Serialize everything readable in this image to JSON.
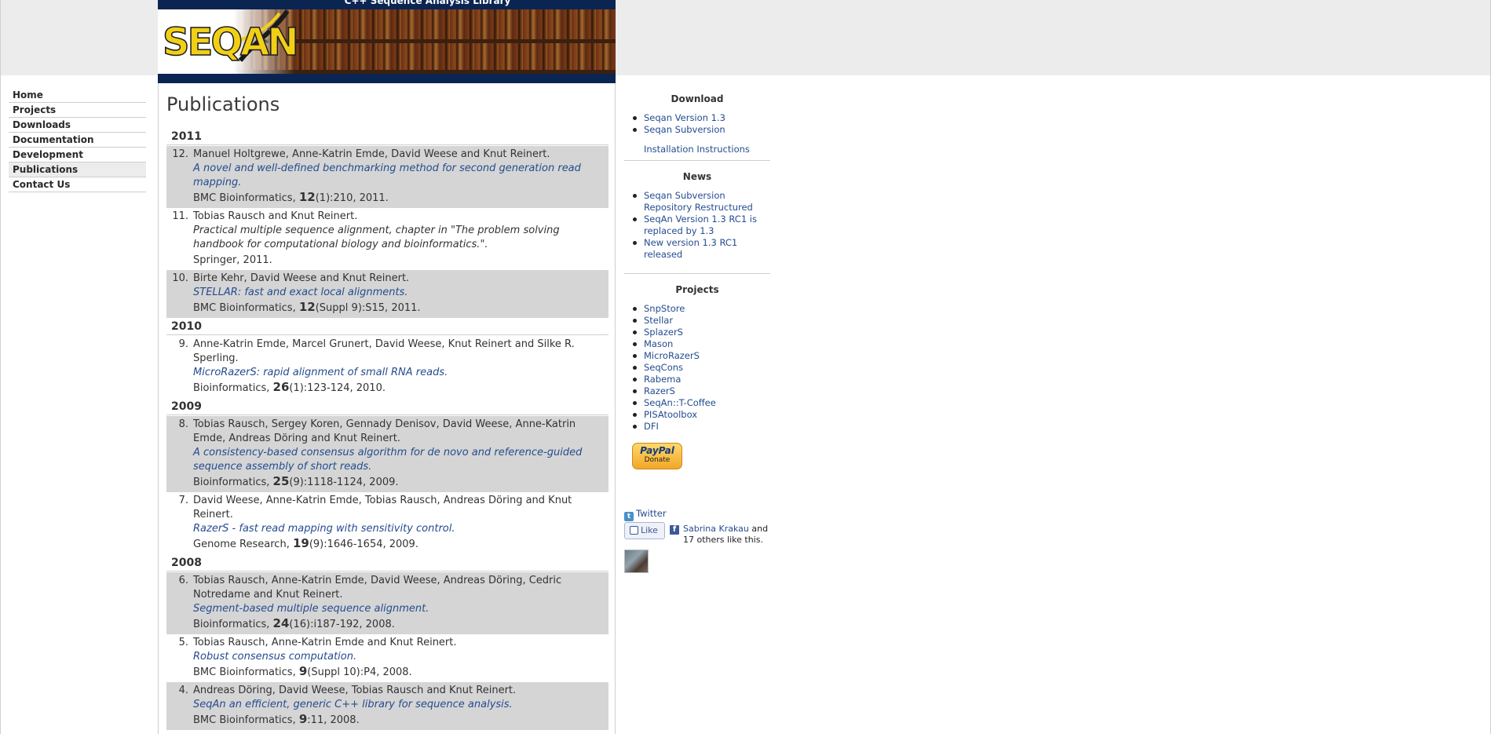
{
  "header": {
    "banner_title": "C++ Sequence Analysis Library",
    "logo_text": "SEQAN"
  },
  "nav": {
    "items": [
      {
        "label": "Home",
        "active": false
      },
      {
        "label": "Projects",
        "active": false
      },
      {
        "label": "Downloads",
        "active": false
      },
      {
        "label": "Documentation",
        "active": false
      },
      {
        "label": "Development",
        "active": false
      },
      {
        "label": "Publications",
        "active": true
      },
      {
        "label": "Contact Us",
        "active": false
      }
    ]
  },
  "main": {
    "title": "Publications",
    "years": [
      {
        "year": "2011",
        "pubs": [
          {
            "num": "12.",
            "authors": "Manuel Holtgrewe, Anne-Katrin Emde, David Weese and Knut Reinert.",
            "title": "A novel and well-defined benchmarking method for second generation read mapping.",
            "title_link": true,
            "journal": "BMC Bioinformatics, ",
            "volume": "12",
            "rest": "(1):210, 2011.",
            "shaded": true
          },
          {
            "num": "11.",
            "authors": "Tobias Rausch and Knut Reinert.",
            "title": "Practical multiple sequence alignment, chapter in \"The problem solving handbook for computational biology and bioinformatics.\".",
            "title_link": false,
            "journal": "Springer, 2011.",
            "volume": "",
            "rest": "",
            "shaded": false
          },
          {
            "num": "10.",
            "authors": "Birte Kehr, David Weese and Knut Reinert.",
            "title": "STELLAR: fast and exact local alignments.",
            "title_link": true,
            "journal": "BMC Bioinformatics, ",
            "volume": "12",
            "rest": "(Suppl 9):S15, 2011.",
            "shaded": true
          }
        ]
      },
      {
        "year": "2010",
        "pubs": [
          {
            "num": "9.",
            "authors": "Anne-Katrin Emde, Marcel Grunert, David Weese, Knut Reinert and Silke R. Sperling.",
            "title": "MicroRazerS: rapid alignment of small RNA reads.",
            "title_link": true,
            "journal": "Bioinformatics, ",
            "volume": "26",
            "rest": "(1):123-124, 2010.",
            "shaded": false
          }
        ]
      },
      {
        "year": "2009",
        "pubs": [
          {
            "num": "8.",
            "authors": "Tobias Rausch, Sergey Koren, Gennady Denisov, David Weese, Anne-Katrin Emde, Andreas Döring and Knut Reinert.",
            "title": "A consistency-based consensus algorithm for de novo and reference-guided sequence assembly of short reads.",
            "title_link": true,
            "journal": "Bioinformatics, ",
            "volume": "25",
            "rest": "(9):1118-1124, 2009.",
            "shaded": true
          },
          {
            "num": "7.",
            "authors": "David Weese, Anne-Katrin Emde, Tobias Rausch, Andreas Döring and Knut Reinert.",
            "title": "RazerS - fast read mapping with sensitivity control.",
            "title_link": true,
            "journal": "Genome Research, ",
            "volume": "19",
            "rest": "(9):1646-1654, 2009.",
            "shaded": false
          }
        ]
      },
      {
        "year": "2008",
        "pubs": [
          {
            "num": "6.",
            "authors": "Tobias Rausch, Anne-Katrin Emde, David Weese, Andreas Döring, Cedric Notredame and Knut Reinert.",
            "title": "Segment-based multiple sequence alignment.",
            "title_link": true,
            "journal": "Bioinformatics, ",
            "volume": "24",
            "rest": "(16):i187-192, 2008.",
            "shaded": true
          },
          {
            "num": "5.",
            "authors": "Tobias Rausch, Anne-Katrin Emde and Knut Reinert.",
            "title": "Robust consensus computation.",
            "title_link": true,
            "journal": "BMC Bioinformatics, ",
            "volume": "9",
            "rest": "(Suppl 10):P4, 2008.",
            "shaded": false
          },
          {
            "num": "4.",
            "authors": "Andreas Döring, David Weese, Tobias Rausch and Knut Reinert.",
            "title": "SeqAn an efficient, generic C++ library for sequence analysis.",
            "title_link": true,
            "journal": "BMC Bioinformatics, ",
            "volume": "9",
            "rest": ":11, 2008.",
            "shaded": true
          }
        ]
      }
    ]
  },
  "sidebar": {
    "download": {
      "heading": "Download",
      "links": [
        "Seqan Version 1.3",
        "Seqan Subversion"
      ],
      "extra": "Installation Instructions"
    },
    "news": {
      "heading": "News",
      "links": [
        "Seqan Subversion Repository Restructured",
        "SeqAn Version 1.3 RC1 is replaced by 1.3",
        "New version 1.3 RC1 released"
      ]
    },
    "projects": {
      "heading": "Projects",
      "links": [
        "SnpStore",
        "Stellar",
        "SplazerS",
        "Mason",
        "MicroRazerS",
        "SeqCons",
        "Rabema",
        "RazerS",
        "SeqAn::T-Coffee",
        "PISAtoolbox",
        "DFI"
      ]
    },
    "paypal": {
      "logo": "PayPal",
      "label": "Donate"
    },
    "twitter": {
      "label": "Twitter",
      "icon": "twitter-icon"
    },
    "facebook": {
      "like_label": "Like",
      "name": "Sabrina Krakau",
      "text_after": " and 17 others like this."
    }
  },
  "colors": {
    "link": "#244c8f",
    "banner": "#0b2553",
    "logo": "#f1cf17",
    "shaded_row": "#d5d5d5"
  }
}
